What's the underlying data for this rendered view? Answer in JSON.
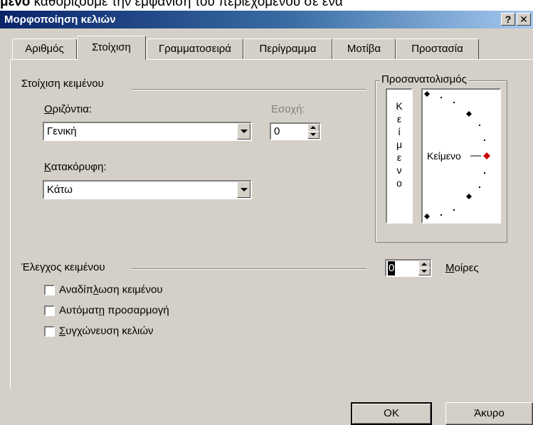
{
  "caption": {
    "bold": "μένο",
    "rest": " καθορίζουμε την εμφάνιση του περιεχομένου σε ένα"
  },
  "window": {
    "title": "Μορφοποίηση κελιών",
    "help_button": "?",
    "close_button": "✕"
  },
  "tabs": [
    {
      "label": "Αριθμός",
      "active": false
    },
    {
      "label": "Στοίχιση",
      "active": true
    },
    {
      "label": "Γραμματοσειρά",
      "active": false
    },
    {
      "label": "Περίγραμμα",
      "active": false
    },
    {
      "label": "Μοτίβα",
      "active": false
    },
    {
      "label": "Προστασία",
      "active": false
    }
  ],
  "alignment": {
    "group_label": "Στοίχιση κειμένου",
    "horizontal": {
      "label_mnemonic": "Ο",
      "label_rest": "ριζόντια:",
      "value": "Γενική"
    },
    "indent": {
      "label": "Εσοχή:",
      "value": "0"
    },
    "vertical": {
      "label_mnemonic": "Κ",
      "label_rest": "ατακόρυφη:",
      "value": "Κάτω"
    }
  },
  "text_control": {
    "group_label": "Έλεγχος κειμένου",
    "wrap": {
      "pre": "Αναδίπ",
      "mnemonic": "λ",
      "post": "ωση κειμένου",
      "checked": false
    },
    "shrink": {
      "pre": "Αυτόματ",
      "mnemonic": "η",
      "post": " προσαρμογή",
      "checked": false
    },
    "merge": {
      "pre": "",
      "mnemonic": "Σ",
      "post": "υγχώνευση κελιών",
      "checked": false
    }
  },
  "orientation": {
    "group_label": "Προσανατολισμός",
    "vertical_text_letters": [
      "Κ",
      "ε",
      "ί",
      "μ",
      "ε",
      "ν",
      "ο"
    ],
    "dial_text": "Κείμενο",
    "degrees_value": "0",
    "degrees_label_mnemonic": "Μ",
    "degrees_label_rest": "οίρες",
    "marker_color": "#cc0000"
  },
  "buttons": {
    "ok": "OK",
    "cancel": "Άκυρο"
  }
}
